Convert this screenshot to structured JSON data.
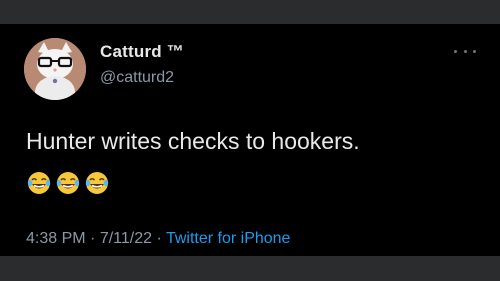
{
  "tweet": {
    "display_name": "Catturd ™",
    "handle": "@catturd2",
    "text": "Hunter writes checks to hookers.",
    "emojis": [
      "face-with-tears-of-joy-icon",
      "face-with-tears-of-joy-icon",
      "face-with-tears-of-joy-icon"
    ],
    "time": "4:38 PM",
    "separator": " · ",
    "date": "7/11/22",
    "source": "Twitter for iPhone"
  },
  "colors": {
    "background": "#000000",
    "frame": "#2a2c2e",
    "primary_text": "#e7e9ea",
    "secondary_text": "#8b98a5",
    "link": "#1d9bf0"
  },
  "icons": {
    "more": "more-options-icon",
    "avatar": "cat-with-glasses-avatar"
  }
}
